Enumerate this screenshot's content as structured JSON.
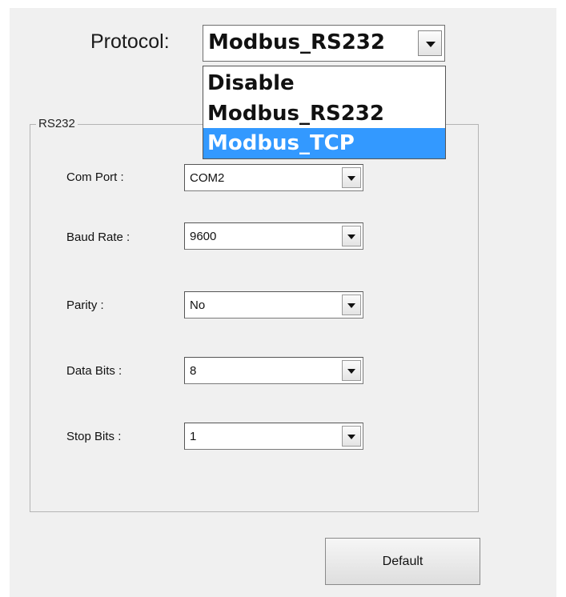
{
  "protocol": {
    "label": "Protocol:",
    "value": "Modbus_RS232",
    "dropdown_icon": "chevron-down-icon",
    "options": [
      "Disable",
      "Modbus_RS232",
      "Modbus_TCP"
    ],
    "highlighted_option": "Modbus_TCP",
    "highlight_color": "#3399ff"
  },
  "rs232": {
    "title": "RS232",
    "fields": [
      {
        "label": "Com Port :",
        "value": "COM2"
      },
      {
        "label": "Baud Rate :",
        "value": "9600"
      },
      {
        "label": "Parity :",
        "value": "No"
      },
      {
        "label": "Data Bits :",
        "value": "8"
      },
      {
        "label": "Stop Bits :",
        "value": "1"
      }
    ]
  },
  "buttons": {
    "default_label": "Default"
  }
}
